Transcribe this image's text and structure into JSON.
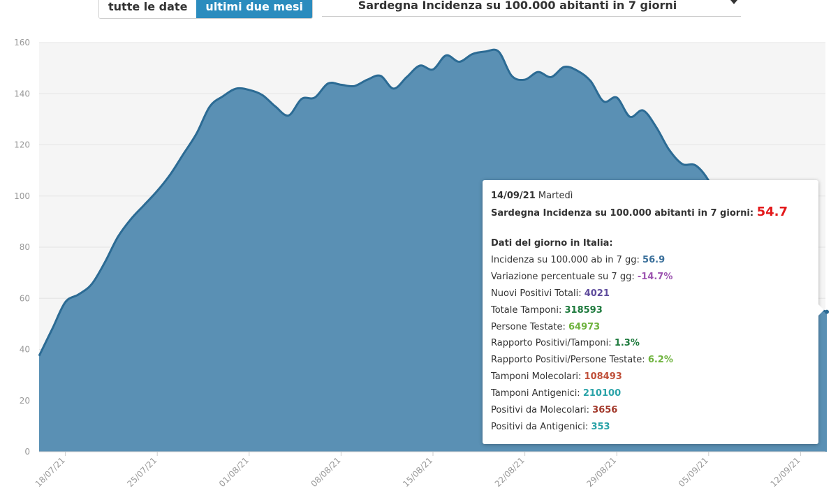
{
  "controls": {
    "date_buttons": [
      {
        "label": "tutte le date",
        "active": false
      },
      {
        "label": "ultimi due mesi",
        "active": true
      }
    ],
    "metric_select": {
      "value": "Sardegna Incidenza su 100.000 abitanti in 7 giorni"
    }
  },
  "tooltip": {
    "date": "14/09/21",
    "weekday": "Martedì",
    "headline_label": "Sardegna Incidenza su 100.000 abitanti in 7 giorni:",
    "headline_value": "54.7",
    "headline_color": "#e31a1c",
    "section_title": "Dati del giorno in Italia:",
    "rows": [
      {
        "label": "Incidenza su 100.000 ab in 7 gg:",
        "value": "56.9",
        "color": "#3a6f9a"
      },
      {
        "label": "Variazione percentuale su 7 gg:",
        "value": "-14.7%",
        "color": "#9d55b0"
      },
      {
        "label": "Nuovi Positivi Totali:",
        "value": "4021",
        "color": "#5e4b9c"
      },
      {
        "label": "Totale Tamponi:",
        "value": "318593",
        "color": "#1e7a3d"
      },
      {
        "label": "Persone Testate:",
        "value": "64973",
        "color": "#6fb33f"
      },
      {
        "label": "Rapporto Positivi/Tamponi:",
        "value": "1.3%",
        "color": "#1e7a3d"
      },
      {
        "label": "Rapporto Positivi/Persone Testate:",
        "value": "6.2%",
        "color": "#6fb33f"
      },
      {
        "label": "Tamponi Molecolari:",
        "value": "108493",
        "color": "#c0503a"
      },
      {
        "label": "Tamponi Antigenici:",
        "value": "210100",
        "color": "#2aa3a8"
      },
      {
        "label": "Positivi da Molecolari:",
        "value": "3656",
        "color": "#a33a2c"
      },
      {
        "label": "Positivi da Antigenici:",
        "value": "353",
        "color": "#2aa3a8"
      }
    ]
  },
  "chart_data": {
    "type": "area",
    "series": [
      {
        "color": "#2c6b94",
        "fill": "#5a90b4",
        "points": [
          [
            "2021-07-16",
            37.5
          ],
          [
            "2021-07-17",
            48
          ],
          [
            "2021-07-18",
            58.5
          ],
          [
            "2021-07-19",
            61.5
          ],
          [
            "2021-07-20",
            65.5
          ],
          [
            "2021-07-21",
            74
          ],
          [
            "2021-07-22",
            84
          ],
          [
            "2021-07-23",
            91
          ],
          [
            "2021-07-24",
            96.5
          ],
          [
            "2021-07-25",
            102
          ],
          [
            "2021-07-26",
            108.5
          ],
          [
            "2021-07-27",
            116.5
          ],
          [
            "2021-07-28",
            124.5
          ],
          [
            "2021-07-29",
            135
          ],
          [
            "2021-07-30",
            139
          ],
          [
            "2021-07-31",
            142
          ],
          [
            "2021-08-01",
            141.5
          ],
          [
            "2021-08-02",
            139.5
          ],
          [
            "2021-08-03",
            135
          ],
          [
            "2021-08-04",
            131.5
          ],
          [
            "2021-08-05",
            138
          ],
          [
            "2021-08-06",
            138.5
          ],
          [
            "2021-08-07",
            144
          ],
          [
            "2021-08-08",
            143.5
          ],
          [
            "2021-08-09",
            143
          ],
          [
            "2021-08-10",
            145.5
          ],
          [
            "2021-08-11",
            147
          ],
          [
            "2021-08-12",
            142
          ],
          [
            "2021-08-13",
            146.5
          ],
          [
            "2021-08-14",
            151
          ],
          [
            "2021-08-15",
            149.5
          ],
          [
            "2021-08-16",
            155
          ],
          [
            "2021-08-17",
            152.5
          ],
          [
            "2021-08-18",
            155.5
          ],
          [
            "2021-08-19",
            156.5
          ],
          [
            "2021-08-20",
            156.5
          ],
          [
            "2021-08-21",
            147
          ],
          [
            "2021-08-22",
            145.5
          ],
          [
            "2021-08-23",
            148.5
          ],
          [
            "2021-08-24",
            146.5
          ],
          [
            "2021-08-25",
            150.5
          ],
          [
            "2021-08-26",
            149
          ],
          [
            "2021-08-27",
            145
          ],
          [
            "2021-08-28",
            137
          ],
          [
            "2021-08-29",
            138.5
          ],
          [
            "2021-08-30",
            131
          ],
          [
            "2021-08-31",
            133.5
          ],
          [
            "2021-09-01",
            127
          ],
          [
            "2021-09-02",
            118
          ],
          [
            "2021-09-03",
            112.5
          ],
          [
            "2021-09-04",
            112
          ],
          [
            "2021-09-05",
            106
          ],
          [
            "2021-09-06",
            95
          ],
          [
            "2021-09-07",
            85
          ],
          [
            "2021-09-08",
            76
          ],
          [
            "2021-09-09",
            68
          ],
          [
            "2021-09-10",
            63
          ],
          [
            "2021-09-11",
            60
          ],
          [
            "2021-09-12",
            58
          ],
          [
            "2021-09-13",
            56.5
          ],
          [
            "2021-09-14",
            54.7
          ]
        ]
      }
    ],
    "x_range": [
      "2021-07-16",
      "2021-09-14"
    ],
    "x_tick_labels": [
      "18/07/21",
      "25/07/21",
      "01/08/21",
      "08/08/21",
      "15/08/21",
      "22/08/21",
      "29/08/21",
      "05/09/21",
      "12/09/21"
    ],
    "x_tick_dates": [
      "2021-07-18",
      "2021-07-25",
      "2021-08-01",
      "2021-08-08",
      "2021-08-15",
      "2021-08-22",
      "2021-08-29",
      "2021-09-05",
      "2021-09-12"
    ],
    "y_ticks": [
      0,
      20,
      40,
      60,
      80,
      100,
      120,
      140,
      160
    ],
    "ylim": [
      0,
      160
    ],
    "grid": true,
    "title": "",
    "xlabel": "",
    "ylabel": ""
  }
}
